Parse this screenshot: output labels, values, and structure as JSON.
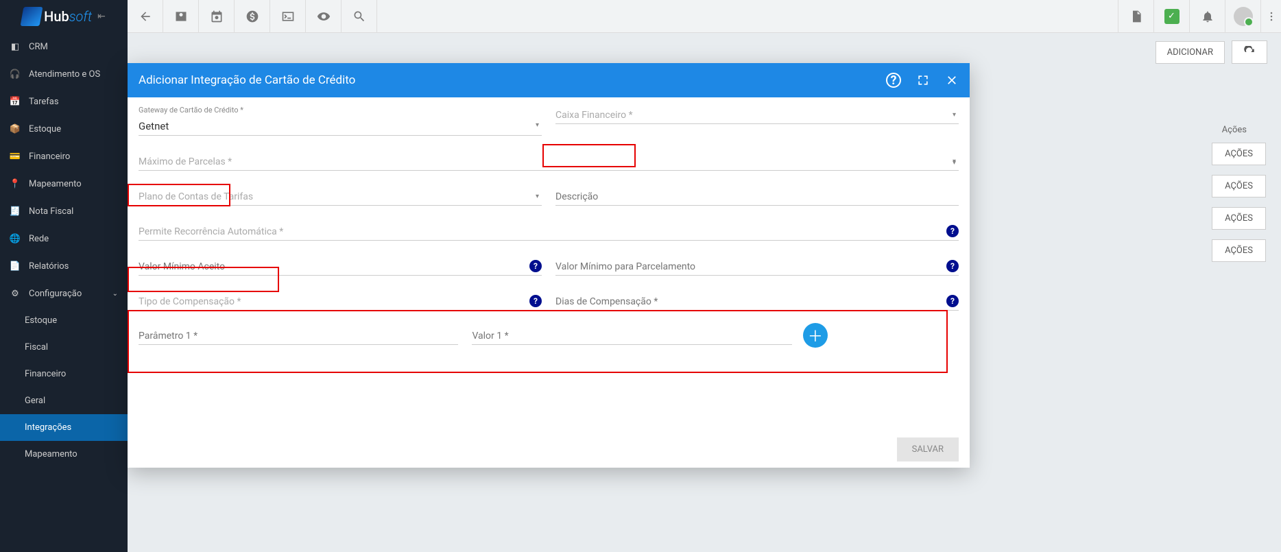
{
  "logo": {
    "brand": "Hub",
    "brand2": "soft"
  },
  "sidebar": {
    "items": [
      {
        "label": "CRM"
      },
      {
        "label": "Atendimento e OS"
      },
      {
        "label": "Tarefas"
      },
      {
        "label": "Estoque"
      },
      {
        "label": "Financeiro"
      },
      {
        "label": "Mapeamento"
      },
      {
        "label": "Nota Fiscal"
      },
      {
        "label": "Rede"
      },
      {
        "label": "Relatórios"
      },
      {
        "label": "Configuração"
      }
    ],
    "sub": [
      {
        "label": "Estoque"
      },
      {
        "label": "Fiscal"
      },
      {
        "label": "Financeiro"
      },
      {
        "label": "Geral"
      },
      {
        "label": "Integrações"
      },
      {
        "label": "Mapeamento"
      }
    ]
  },
  "toolbar": {
    "adicionar": "ADICIONAR"
  },
  "table": {
    "actions_header": "Ações",
    "acoes_btn": "AÇÕES"
  },
  "modal": {
    "title": "Adicionar Integração de Cartão de Crédito",
    "gateway_label": "Gateway de Cartão de Crédito *",
    "gateway_value": "Getnet",
    "caixa_placeholder": "Caixa Financeiro *",
    "max_parcelas_placeholder": "Máximo de Parcelas *",
    "plano_placeholder": "Plano de Contas de Tarifas",
    "descricao_placeholder": "Descrição",
    "recorrencia_placeholder": "Permite Recorrência Automática *",
    "valor_min_placeholder": "Valor Mínimo Aceito",
    "valor_min_parc_placeholder": "Valor Mínimo para Parcelamento",
    "tipo_comp_placeholder": "Tipo de Compensação *",
    "dias_comp_placeholder": "Dias de Compensação *",
    "param1_placeholder": "Parâmetro 1 *",
    "valor1_placeholder": "Valor 1 *",
    "save": "SALVAR"
  }
}
